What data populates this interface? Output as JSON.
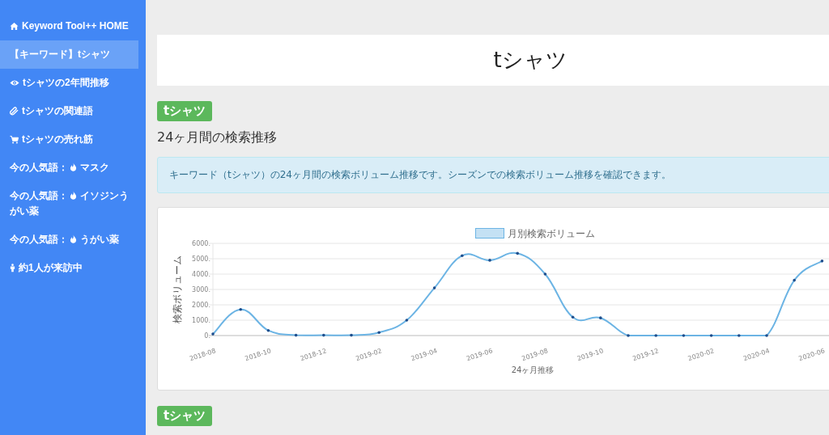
{
  "sidebar": {
    "items": [
      {
        "kind": "home",
        "label": "Keyword Tool++ HOME",
        "selected": false
      },
      {
        "kind": "plain",
        "label": "【キーワード】tシャツ",
        "selected": true
      },
      {
        "kind": "eye",
        "label": "tシャツの2年間推移",
        "selected": false
      },
      {
        "kind": "clip",
        "label": "tシャツの関連語",
        "selected": false
      },
      {
        "kind": "cart",
        "label": "tシャツの売れ筋",
        "selected": false
      },
      {
        "kind": "trend",
        "prefix": "今の人気語：",
        "label": "マスク",
        "selected": false
      },
      {
        "kind": "trend",
        "prefix": "今の人気語：",
        "label": "イソジンうがい薬",
        "selected": false
      },
      {
        "kind": "trend",
        "prefix": "今の人気語：",
        "label": "うがい薬",
        "selected": false
      },
      {
        "kind": "visitors",
        "label": "約1人が来訪中",
        "selected": false
      }
    ]
  },
  "page_title": "tシャツ",
  "sections": [
    {
      "badge": "tシャツ",
      "heading": "24ヶ月間の検索推移",
      "info": "キーワード（tシャツ）の24ヶ月間の検索ボリューム推移です。シーズンでの検索ボリューム推移を確認できます。",
      "chart_data": {
        "type": "line",
        "xlabel": "24ヶ月推移",
        "ylabel": "検索ボリューム",
        "categories": [
          "2018-08",
          null,
          "2018-10",
          null,
          "2018-12",
          null,
          "2019-02",
          null,
          "2019-04",
          null,
          "2019-06",
          null,
          "2019-08",
          null,
          "2019-10",
          null,
          "2019-12",
          null,
          "2020-02",
          null,
          "2020-04",
          null,
          "2020-06"
        ],
        "grid": true,
        "series": [
          {
            "name": "月別検索ボリューム",
            "color": "#6cb4e4",
            "values": [
              100,
              1700,
              330,
              20,
              20,
              20,
              200,
              1000,
              3100,
              5200,
              4900,
              5350,
              4000,
              1200,
              1150,
              0,
              0,
              0,
              0,
              0,
              0,
              3600,
              4850
            ]
          }
        ],
        "ylim": [
          0,
          6000
        ],
        "yticks": [
          {
            "value": 0,
            "label": "0."
          },
          {
            "value": 1000,
            "label": "1000."
          },
          {
            "value": 2000,
            "label": "2000."
          },
          {
            "value": 3000,
            "label": "3000."
          },
          {
            "value": 4000,
            "label": "4000."
          },
          {
            "value": 5000,
            "label": "5000."
          },
          {
            "value": 6000,
            "label": "6000."
          }
        ]
      }
    },
    {
      "badge": "tシャツ"
    }
  ]
}
